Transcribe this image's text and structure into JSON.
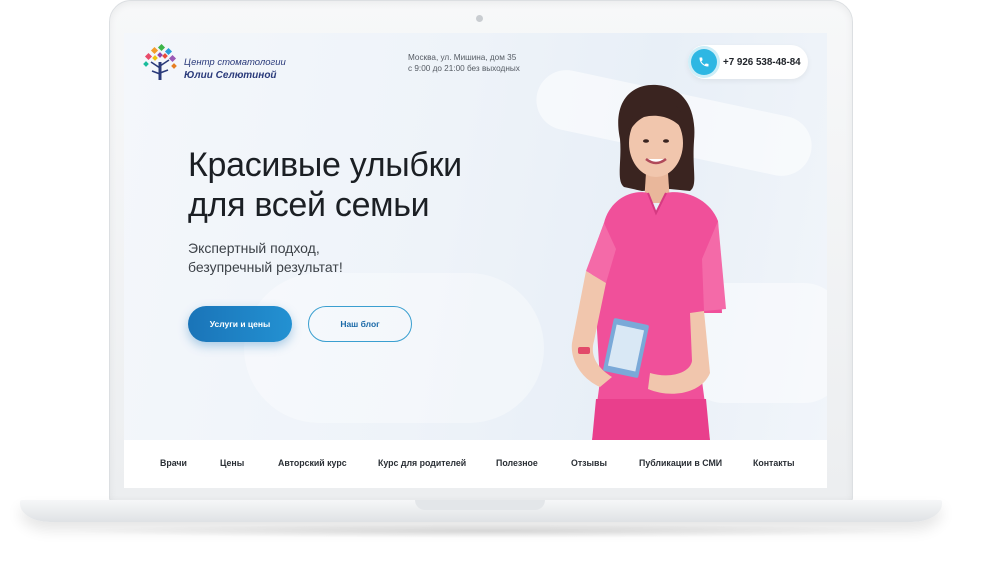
{
  "logo": {
    "line1": "Центр стоматологии",
    "line2": "Юлии Селютиной"
  },
  "header": {
    "address_line1": "Москва, ул. Мишина, дом 35",
    "address_line2": "с 9:00 до 21:00 без выходных",
    "phone": "+7 926 538-48-84"
  },
  "hero": {
    "title_line1": "Красивые улыбки",
    "title_line2": "для всей семьи",
    "subtitle_line1": "Экспертный подход,",
    "subtitle_line2": "безупречный результат!",
    "primary_button": "Услуги и цены",
    "secondary_button": "Наш блог"
  },
  "nav": {
    "items": [
      "Врачи",
      "Цены",
      "Авторский курс",
      "Курс для родителей",
      "Полезное",
      "Отзывы",
      "Публикации в СМИ",
      "Контакты"
    ]
  },
  "colors": {
    "accent": "#2391d2",
    "phone_icon": "#2eb7e3",
    "uniform": "#f0509a"
  }
}
